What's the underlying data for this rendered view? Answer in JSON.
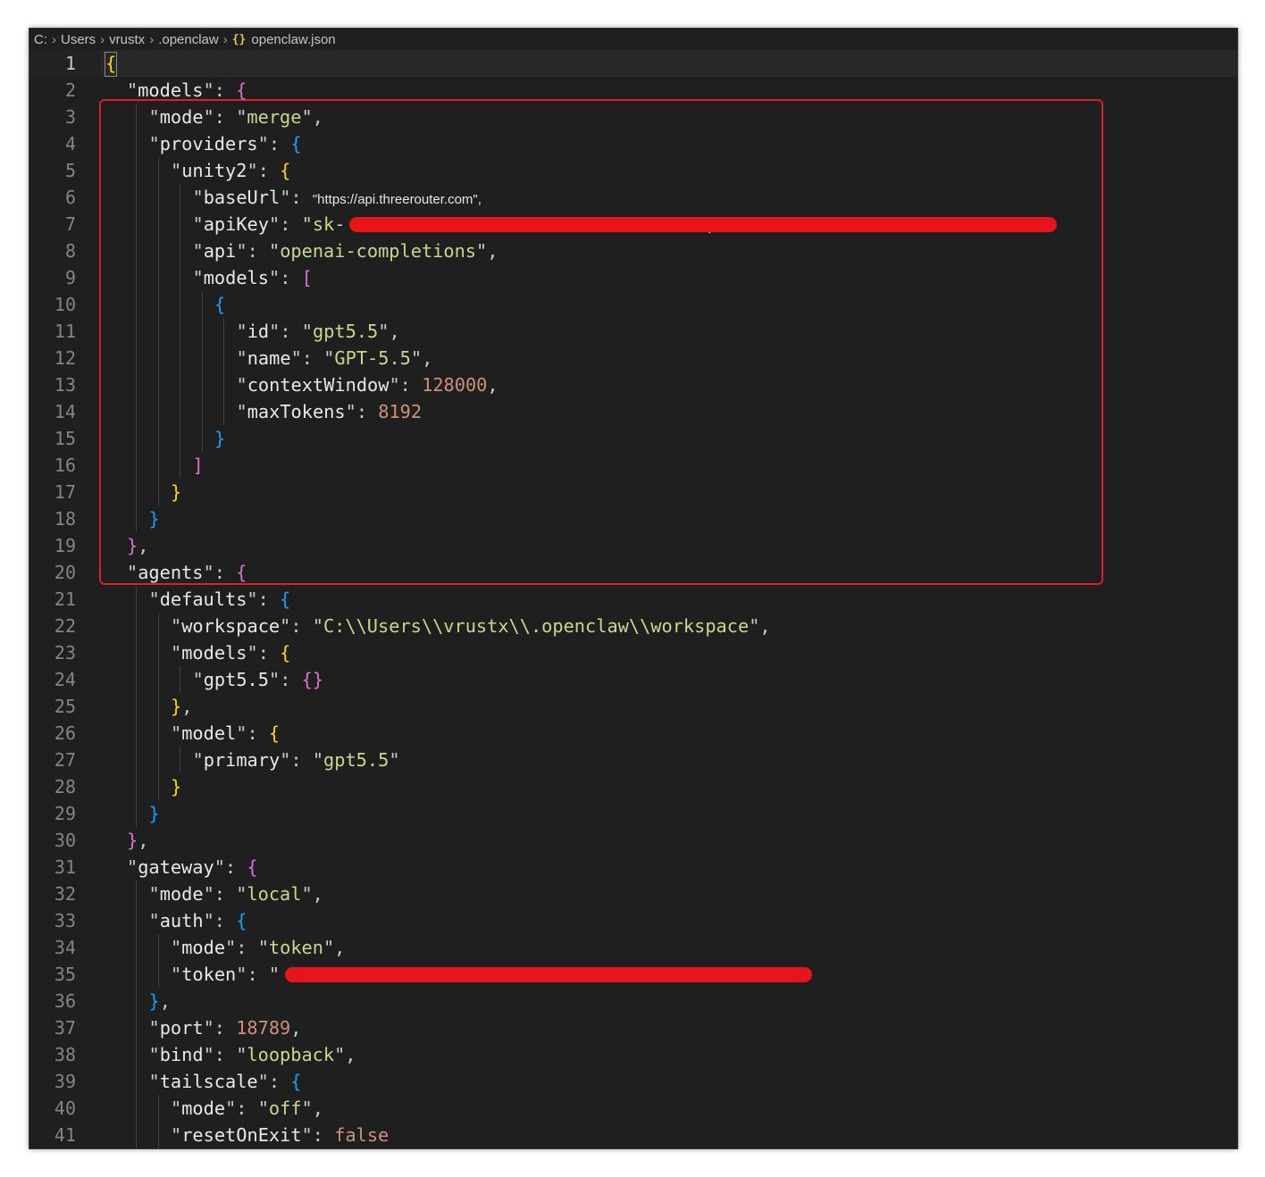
{
  "breadcrumb": {
    "segments": [
      "C:",
      "Users",
      "vrustx",
      ".openclaw"
    ],
    "file_icon": "{}",
    "file_name": "openclaw.json"
  },
  "lines": [
    {
      "n": "1",
      "indent": 0,
      "parts": [
        [
          "b1",
          "{"
        ]
      ]
    },
    {
      "n": "2",
      "indent": 1,
      "parts": [
        [
          "q",
          "\""
        ],
        [
          "kk",
          "models"
        ],
        [
          "q",
          "\": "
        ],
        [
          "b2",
          "{"
        ]
      ]
    },
    {
      "n": "3",
      "indent": 2,
      "parts": [
        [
          "q",
          "\""
        ],
        [
          "kk",
          "mode"
        ],
        [
          "q",
          "\": \""
        ],
        [
          "str",
          "merge"
        ],
        [
          "q",
          "\","
        ]
      ]
    },
    {
      "n": "4",
      "indent": 2,
      "parts": [
        [
          "q",
          "\""
        ],
        [
          "kk",
          "providers"
        ],
        [
          "q",
          "\": "
        ],
        [
          "b3",
          "{"
        ]
      ]
    },
    {
      "n": "5",
      "indent": 3,
      "parts": [
        [
          "q",
          "\""
        ],
        [
          "kk",
          "unity2"
        ],
        [
          "q",
          "\": "
        ],
        [
          "b1",
          "{"
        ]
      ]
    },
    {
      "n": "6",
      "indent": 4,
      "parts": [
        [
          "q",
          "\""
        ],
        [
          "kk",
          "baseUrl"
        ],
        [
          "q",
          "\": "
        ],
        [
          "small",
          "\"https://api.threerouter.com\","
        ]
      ]
    },
    {
      "n": "7",
      "indent": 4,
      "parts": [
        [
          "q",
          "\""
        ],
        [
          "kk",
          "apiKey"
        ],
        [
          "q",
          "\": \""
        ],
        [
          "str",
          "sk-"
        ],
        [
          "gap",
          "                                "
        ],
        [
          "q",
          "\","
        ]
      ]
    },
    {
      "n": "8",
      "indent": 4,
      "parts": [
        [
          "q",
          "\""
        ],
        [
          "kk",
          "api"
        ],
        [
          "q",
          "\": \""
        ],
        [
          "str",
          "openai-completions"
        ],
        [
          "q",
          "\","
        ]
      ]
    },
    {
      "n": "9",
      "indent": 4,
      "parts": [
        [
          "q",
          "\""
        ],
        [
          "kk",
          "models"
        ],
        [
          "q",
          "\": "
        ],
        [
          "b2",
          "["
        ]
      ]
    },
    {
      "n": "10",
      "indent": 5,
      "parts": [
        [
          "b3",
          "{"
        ]
      ]
    },
    {
      "n": "11",
      "indent": 6,
      "parts": [
        [
          "q",
          "\""
        ],
        [
          "kk",
          "id"
        ],
        [
          "q",
          "\": \""
        ],
        [
          "str",
          "gpt5.5"
        ],
        [
          "q",
          "\","
        ]
      ]
    },
    {
      "n": "12",
      "indent": 6,
      "parts": [
        [
          "q",
          "\""
        ],
        [
          "kk",
          "name"
        ],
        [
          "q",
          "\": \""
        ],
        [
          "str",
          "GPT-5.5"
        ],
        [
          "q",
          "\","
        ]
      ]
    },
    {
      "n": "13",
      "indent": 6,
      "parts": [
        [
          "q",
          "\""
        ],
        [
          "kk",
          "contextWindow"
        ],
        [
          "q",
          "\": "
        ],
        [
          "s",
          "128000"
        ],
        [
          "q",
          ","
        ]
      ]
    },
    {
      "n": "14",
      "indent": 6,
      "parts": [
        [
          "q",
          "\""
        ],
        [
          "kk",
          "maxTokens"
        ],
        [
          "q",
          "\": "
        ],
        [
          "s",
          "8192"
        ]
      ]
    },
    {
      "n": "15",
      "indent": 5,
      "parts": [
        [
          "b3",
          "}"
        ]
      ]
    },
    {
      "n": "16",
      "indent": 4,
      "parts": [
        [
          "b2",
          "]"
        ]
      ]
    },
    {
      "n": "17",
      "indent": 3,
      "parts": [
        [
          "b1",
          "}"
        ]
      ]
    },
    {
      "n": "18",
      "indent": 2,
      "parts": [
        [
          "b3",
          "}"
        ]
      ]
    },
    {
      "n": "19",
      "indent": 1,
      "parts": [
        [
          "b2",
          "}"
        ],
        [
          "q",
          ","
        ]
      ]
    },
    {
      "n": "20",
      "indent": 1,
      "parts": [
        [
          "q",
          "\""
        ],
        [
          "kk",
          "agents"
        ],
        [
          "q",
          "\": "
        ],
        [
          "b2",
          "{"
        ]
      ]
    },
    {
      "n": "21",
      "indent": 2,
      "parts": [
        [
          "q",
          "\""
        ],
        [
          "kk",
          "defaults"
        ],
        [
          "q",
          "\": "
        ],
        [
          "b3",
          "{"
        ]
      ]
    },
    {
      "n": "22",
      "indent": 3,
      "parts": [
        [
          "q",
          "\""
        ],
        [
          "kk",
          "workspace"
        ],
        [
          "q",
          "\": \""
        ],
        [
          "str",
          "C:\\\\Users\\\\vrustx\\\\.openclaw\\\\workspace"
        ],
        [
          "q",
          "\","
        ]
      ]
    },
    {
      "n": "23",
      "indent": 3,
      "parts": [
        [
          "q",
          "\""
        ],
        [
          "kk",
          "models"
        ],
        [
          "q",
          "\": "
        ],
        [
          "b1",
          "{"
        ]
      ]
    },
    {
      "n": "24",
      "indent": 4,
      "parts": [
        [
          "q",
          "\""
        ],
        [
          "kk",
          "gpt5.5"
        ],
        [
          "q",
          "\": "
        ],
        [
          "b2",
          "{}"
        ]
      ]
    },
    {
      "n": "25",
      "indent": 3,
      "parts": [
        [
          "b1",
          "}"
        ],
        [
          "q",
          ","
        ]
      ]
    },
    {
      "n": "26",
      "indent": 3,
      "parts": [
        [
          "q",
          "\""
        ],
        [
          "kk",
          "model"
        ],
        [
          "q",
          "\": "
        ],
        [
          "b1",
          "{"
        ]
      ]
    },
    {
      "n": "27",
      "indent": 4,
      "parts": [
        [
          "q",
          "\""
        ],
        [
          "kk",
          "primary"
        ],
        [
          "q",
          "\": \""
        ],
        [
          "str",
          "gpt5.5"
        ],
        [
          "q",
          "\""
        ]
      ]
    },
    {
      "n": "28",
      "indent": 3,
      "parts": [
        [
          "b1",
          "}"
        ]
      ]
    },
    {
      "n": "29",
      "indent": 2,
      "parts": [
        [
          "b3",
          "}"
        ]
      ]
    },
    {
      "n": "30",
      "indent": 1,
      "parts": [
        [
          "b2",
          "}"
        ],
        [
          "q",
          ","
        ]
      ]
    },
    {
      "n": "31",
      "indent": 1,
      "parts": [
        [
          "q",
          "\""
        ],
        [
          "kk",
          "gateway"
        ],
        [
          "q",
          "\": "
        ],
        [
          "b2",
          "{"
        ]
      ]
    },
    {
      "n": "32",
      "indent": 2,
      "parts": [
        [
          "q",
          "\""
        ],
        [
          "kk",
          "mode"
        ],
        [
          "q",
          "\": \""
        ],
        [
          "str",
          "local"
        ],
        [
          "q",
          "\","
        ]
      ]
    },
    {
      "n": "33",
      "indent": 2,
      "parts": [
        [
          "q",
          "\""
        ],
        [
          "kk",
          "auth"
        ],
        [
          "q",
          "\": "
        ],
        [
          "b3",
          "{"
        ]
      ]
    },
    {
      "n": "34",
      "indent": 3,
      "parts": [
        [
          "q",
          "\""
        ],
        [
          "kk",
          "mode"
        ],
        [
          "q",
          "\": \""
        ],
        [
          "str",
          "token"
        ],
        [
          "q",
          "\","
        ]
      ]
    },
    {
      "n": "35",
      "indent": 3,
      "parts": [
        [
          "q",
          "\""
        ],
        [
          "kk",
          "token"
        ],
        [
          "q",
          "\": \""
        ],
        [
          "gap",
          "                                           "
        ],
        [
          "q",
          "\""
        ]
      ]
    },
    {
      "n": "36",
      "indent": 2,
      "parts": [
        [
          "b3",
          "}"
        ],
        [
          "q",
          ","
        ]
      ]
    },
    {
      "n": "37",
      "indent": 2,
      "parts": [
        [
          "q",
          "\""
        ],
        [
          "kk",
          "port"
        ],
        [
          "q",
          "\": "
        ],
        [
          "s",
          "18789"
        ],
        [
          "q",
          ","
        ]
      ]
    },
    {
      "n": "38",
      "indent": 2,
      "parts": [
        [
          "q",
          "\""
        ],
        [
          "kk",
          "bind"
        ],
        [
          "q",
          "\": \""
        ],
        [
          "str",
          "loopback"
        ],
        [
          "q",
          "\","
        ]
      ]
    },
    {
      "n": "39",
      "indent": 2,
      "parts": [
        [
          "q",
          "\""
        ],
        [
          "kk",
          "tailscale"
        ],
        [
          "q",
          "\": "
        ],
        [
          "b3",
          "{"
        ]
      ]
    },
    {
      "n": "40",
      "indent": 3,
      "parts": [
        [
          "q",
          "\""
        ],
        [
          "kk",
          "mode"
        ],
        [
          "q",
          "\": \""
        ],
        [
          "str",
          "off"
        ],
        [
          "q",
          "\","
        ]
      ]
    },
    {
      "n": "41",
      "indent": 3,
      "parts": [
        [
          "q",
          "\""
        ],
        [
          "kk",
          "resetOnExit"
        ],
        [
          "q",
          "\": "
        ],
        [
          "s",
          "false"
        ]
      ]
    }
  ]
}
